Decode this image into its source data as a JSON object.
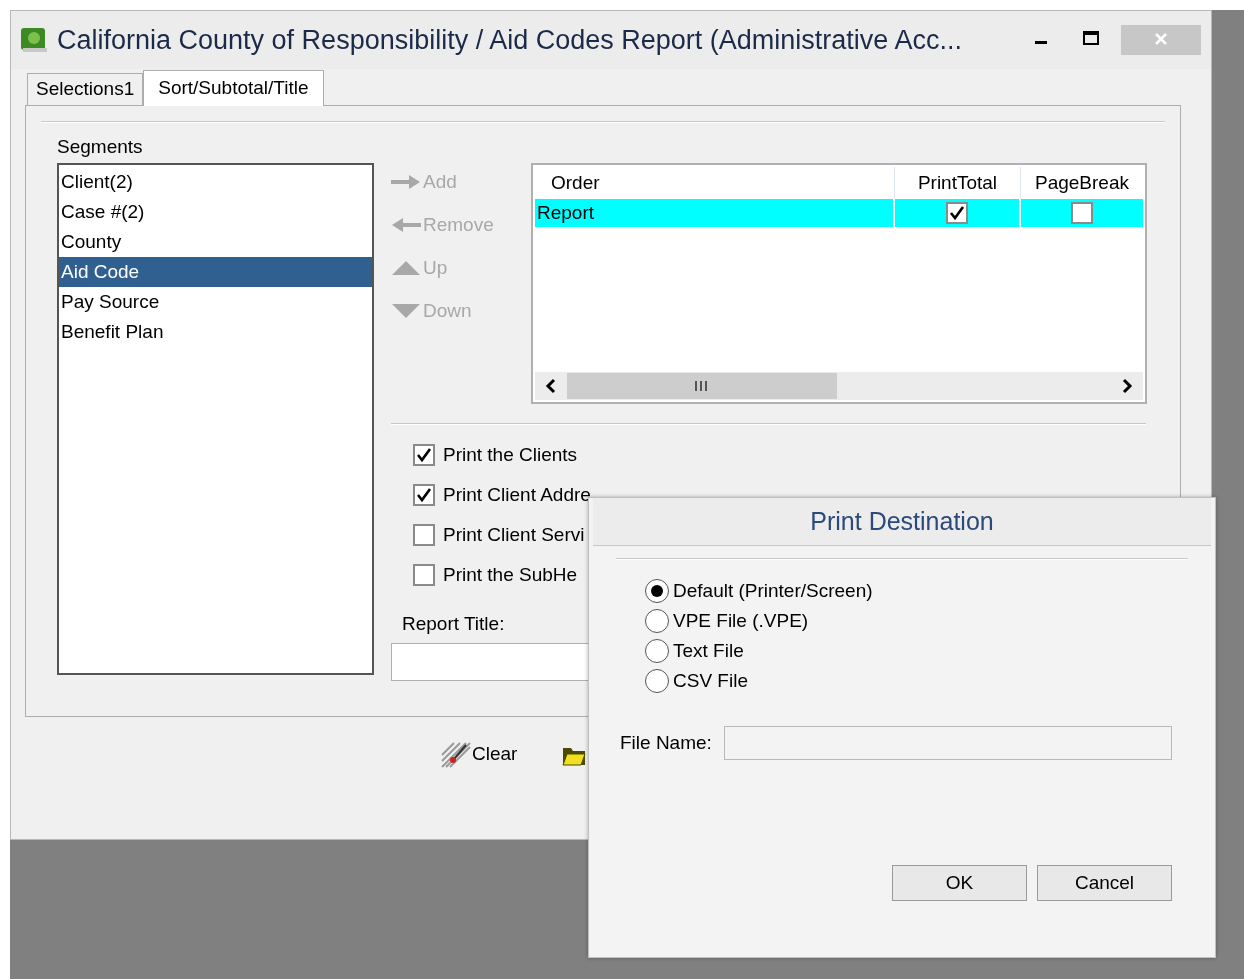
{
  "window": {
    "title": "California County of Responsibility / Aid Codes Report (Administrative Acc..."
  },
  "tabs": [
    {
      "label": "Selections1",
      "selected": false
    },
    {
      "label": "Sort/Subtotal/Title",
      "selected": true
    }
  ],
  "segments": {
    "label": "Segments",
    "items": [
      {
        "label": "Client(2)",
        "selected": false
      },
      {
        "label": "Case #(2)",
        "selected": false
      },
      {
        "label": "County",
        "selected": false
      },
      {
        "label": "Aid Code",
        "selected": true
      },
      {
        "label": "Pay Source",
        "selected": false
      },
      {
        "label": "Benefit Plan",
        "selected": false
      }
    ]
  },
  "move_buttons": [
    {
      "label": "Add",
      "kind": "add",
      "disabled": true
    },
    {
      "label": "Remove",
      "kind": "remove",
      "disabled": true
    },
    {
      "label": "Up",
      "kind": "up",
      "disabled": true
    },
    {
      "label": "Down",
      "kind": "down",
      "disabled": true
    }
  ],
  "grid": {
    "columns": [
      "Order",
      "PrintTotal",
      "PageBreak"
    ],
    "rows": [
      {
        "order": "Report",
        "print_total": true,
        "page_break": false,
        "selected": true
      }
    ]
  },
  "options": [
    {
      "label": "Print the Clients",
      "checked": true
    },
    {
      "label": "Print Client Addre",
      "checked": true
    },
    {
      "label": "Print Client Servi",
      "checked": false
    },
    {
      "label": "Print the SubHe",
      "checked": false
    }
  ],
  "report_title": {
    "label": "Report Title:"
  },
  "toolbar": [
    {
      "kind": "clear",
      "label": "Clear"
    },
    {
      "kind": "open"
    }
  ],
  "dialog": {
    "title": "Print Destination",
    "options": [
      {
        "label": "Default (Printer/Screen)",
        "selected": true
      },
      {
        "label": "VPE File (.VPE)",
        "selected": false
      },
      {
        "label": "Text File",
        "selected": false
      },
      {
        "label": "CSV File",
        "selected": false
      }
    ],
    "file_name": {
      "label": "File Name:"
    },
    "buttons": [
      "OK",
      "Cancel"
    ]
  }
}
